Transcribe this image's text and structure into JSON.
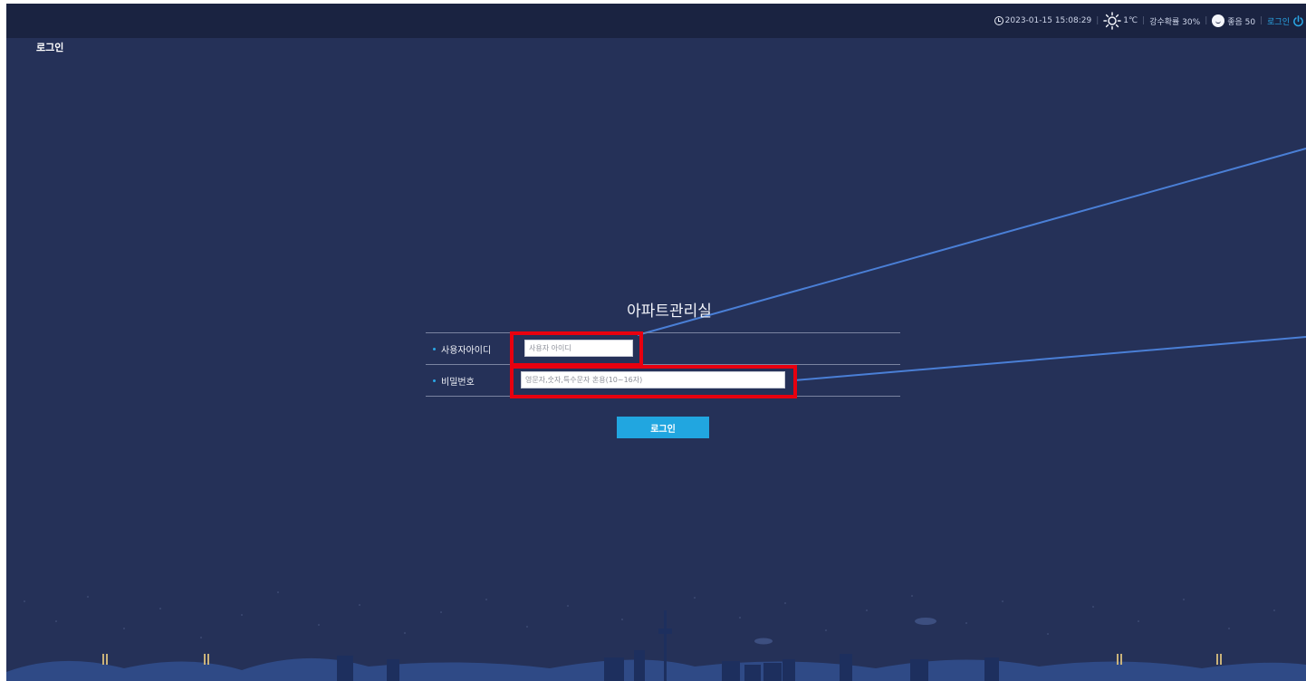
{
  "topbar": {
    "datetime": "2023-01-15 15:08:29",
    "weather_icon": "sun-icon",
    "temperature": "1℃",
    "precipitation": "강수확률 30%",
    "air_icon": "face-icon",
    "air_quality": "좋음 50",
    "login_link": "로그인",
    "power_icon": "power-icon"
  },
  "page": {
    "title": "로그인"
  },
  "login_form": {
    "app_title": "아파트관리실",
    "user_id_label": "사용자아이디",
    "user_id_placeholder": "사용자 아이디",
    "password_label": "비밀번호",
    "password_placeholder": "영문자,숫자,특수문자 혼용(10~16자)",
    "submit_label": "로그인"
  },
  "colors": {
    "background": "#253158",
    "topbar": "#1a2341",
    "accent": "#21a6e0",
    "highlight": "#e8000f",
    "deco_line": "#4a7fd6"
  }
}
